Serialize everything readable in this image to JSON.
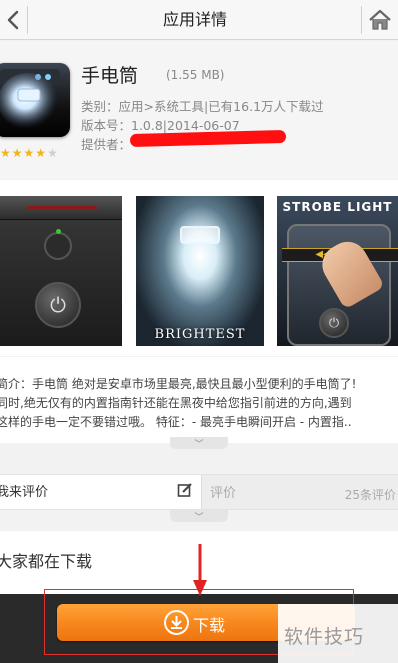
{
  "header": {
    "title": "应用详情",
    "back_icon": "chevron-left-icon",
    "home_icon": "home-icon"
  },
  "app": {
    "name": "手电筒",
    "size": "(1.55 MB)",
    "category_line": "类别：应用>系统工具|已有16.1万人下载过",
    "version_line": "版本号：1.0.8|2014-06-07",
    "provider_label": "提供者：",
    "rating_stars": 4,
    "rating_max": 5
  },
  "screenshots": {
    "captions": [
      "BRIGHTEST",
      "STROBE LIGHT"
    ]
  },
  "description": {
    "lines": [
      "简介：手电筒 绝对是安卓市场里最亮,最快且最小型便利的手电筒了!",
      "同时,绝无仅有的内置指南针还能在黑夜中给您指引前进的方向,遇到",
      "这样的手电一定不要错过哦。 特征：- 最亮手电瞬间开启 - 内置指.."
    ]
  },
  "review": {
    "write_label": "我来评价",
    "tab_label": "评价",
    "count": "25条评价"
  },
  "also_downloaded": {
    "title": "大家都在下载"
  },
  "download": {
    "label": "下载"
  },
  "watermark": {
    "text": "软件技巧"
  },
  "colors": {
    "download_orange": "#f7861c",
    "annotation_red": "#e03030"
  }
}
